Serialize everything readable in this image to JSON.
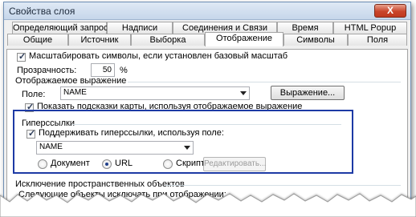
{
  "window": {
    "title": "Свойства слоя",
    "close_label": "X"
  },
  "tabs_row1": [
    "Определяющий запрос",
    "Надписи",
    "Соединения и Связи",
    "Время",
    "HTML Popup"
  ],
  "tabs_row2": [
    "Общие",
    "Источник",
    "Выборка",
    "Отображение",
    "Символы",
    "Поля"
  ],
  "active_tab": "Отображение",
  "display": {
    "scale_symbols_label": "Масштабировать символы, если установлен базовый масштаб",
    "scale_symbols_checked": true,
    "transparency_label": "Прозрачность:",
    "transparency_value": "50",
    "transparency_unit": "%"
  },
  "display_expression": {
    "group_label": "Отображаемое выражение",
    "field_label": "Поле:",
    "field_value": "NAME",
    "expression_button": "Выражение...",
    "map_tips_label": "Показать подсказки карты, используя отображаемое выражение",
    "map_tips_checked": true
  },
  "hyperlinks": {
    "group_label": "Гиперссылки",
    "support_label": "Поддерживать гиперссылки, используя поле:",
    "support_checked": true,
    "field_value": "NAME",
    "options": [
      "Документ",
      "URL",
      "Скрипт"
    ],
    "selected": "URL",
    "edit_button": "Редактировать..."
  },
  "exclusion": {
    "group_label": "Исключение пространственных объектов",
    "description": "Следующие объекты исключать при отображении:"
  }
}
